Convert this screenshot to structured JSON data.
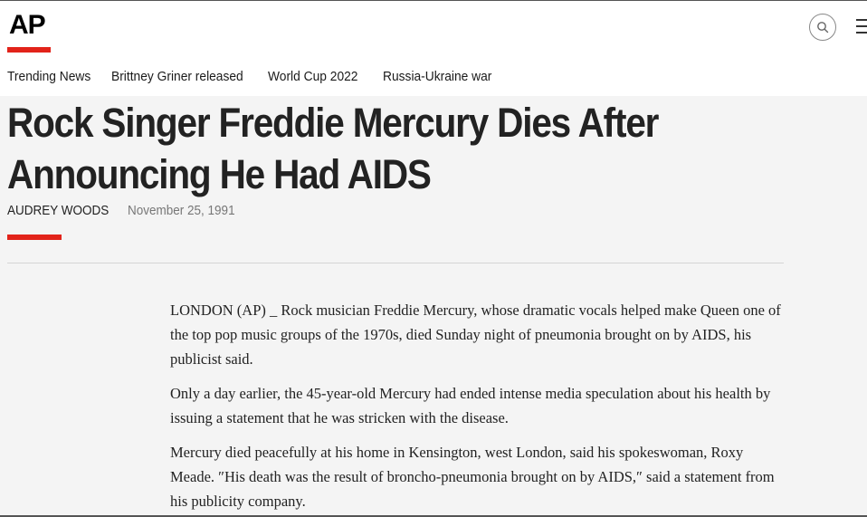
{
  "header": {
    "logo_text": "AP",
    "search_icon": "search-icon",
    "menu_icon": "hamburger-menu-icon",
    "accent_color": "#e2231a"
  },
  "nav": {
    "items": [
      {
        "label": "Trending News"
      },
      {
        "label": "Brittney Griner released"
      },
      {
        "label": "World Cup 2022"
      },
      {
        "label": "Russia-Ukraine war"
      }
    ]
  },
  "article": {
    "headline": "Rock Singer Freddie Mercury Dies After Announcing He Had AIDS",
    "author": "AUDREY WOODS",
    "date": "November 25, 1991",
    "paragraphs": [
      "LONDON (AP) _ Rock musician Freddie Mercury, whose dramatic vocals helped make Queen one of the top pop music groups of the 1970s, died Sunday night of pneumonia brought on by AIDS, his publicist said.",
      "Only a day earlier, the 45-year-old Mercury had ended intense media speculation about his health by issuing a statement that he was stricken with the disease.",
      "Mercury died peacefully at his home in Kensington, west London, said his spokeswoman, Roxy Meade. ″His death was the result of broncho-pneumonia brought on by AIDS,″ said a statement from his publicity company."
    ]
  }
}
